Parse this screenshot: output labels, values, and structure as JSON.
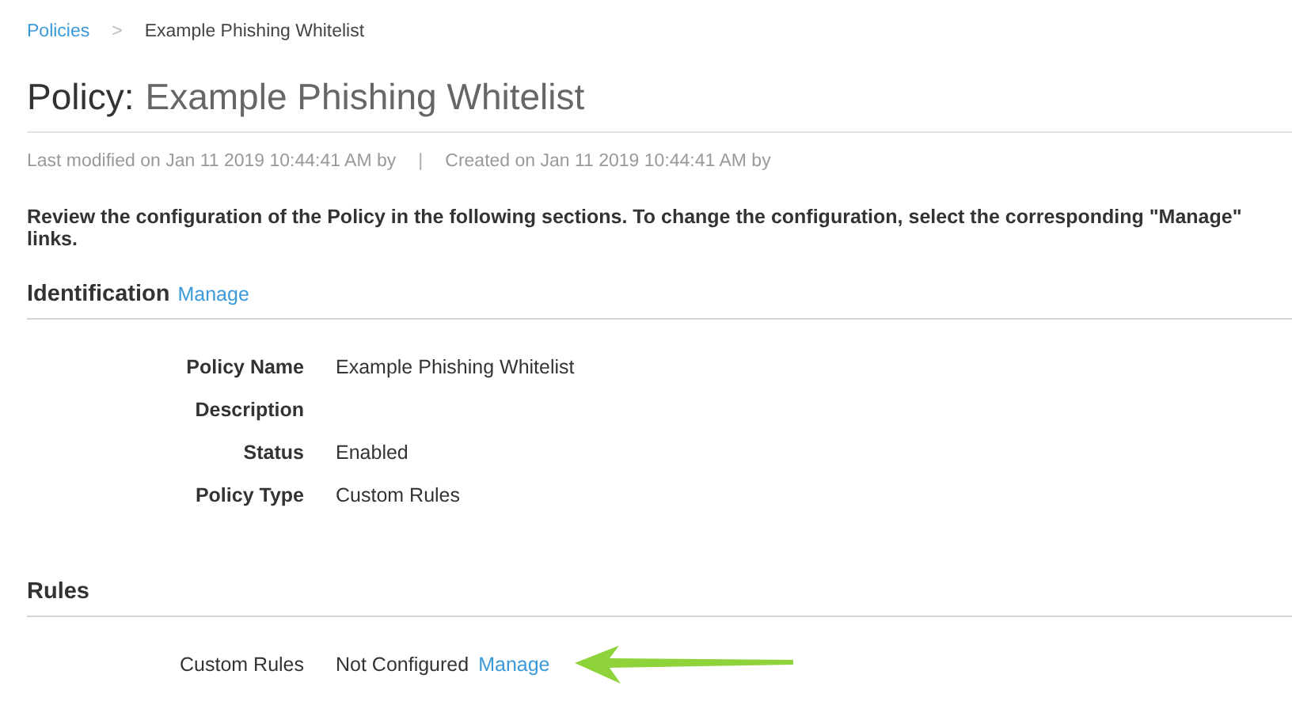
{
  "breadcrumb": {
    "items": [
      {
        "label": "Policies",
        "kind": "link"
      },
      {
        "label": ">",
        "kind": "separator"
      },
      {
        "label": "Example Phishing Whitelist",
        "kind": "current"
      }
    ]
  },
  "title": {
    "prefix": "Policy:",
    "name": "Example Phishing Whitelist"
  },
  "meta": {
    "modified": "Last modified on Jan 11 2019 10:44:41 AM by",
    "separator": "|",
    "created": "Created on Jan 11 2019 10:44:41 AM by"
  },
  "intro": "Review the configuration of the Policy in the following sections. To change the configuration, select the corresponding \"Manage\" links.",
  "sections": [
    {
      "heading": "Identification",
      "link": "Manage",
      "rows": [
        {
          "kind": "field",
          "label": "Policy Name",
          "value": "Example Phishing Whitelist"
        },
        {
          "kind": "field",
          "label": "Description"
        },
        {
          "kind": "field",
          "label": "Status",
          "value": "Enabled"
        },
        {
          "kind": "field",
          "label": "Policy Type",
          "value": "Custom Rules"
        }
      ]
    },
    {
      "heading": "Rules",
      "rows": [
        {
          "kind": "setting",
          "label": "Custom Rules",
          "value": "Not Configured",
          "link": "Manage"
        }
      ]
    }
  ]
}
